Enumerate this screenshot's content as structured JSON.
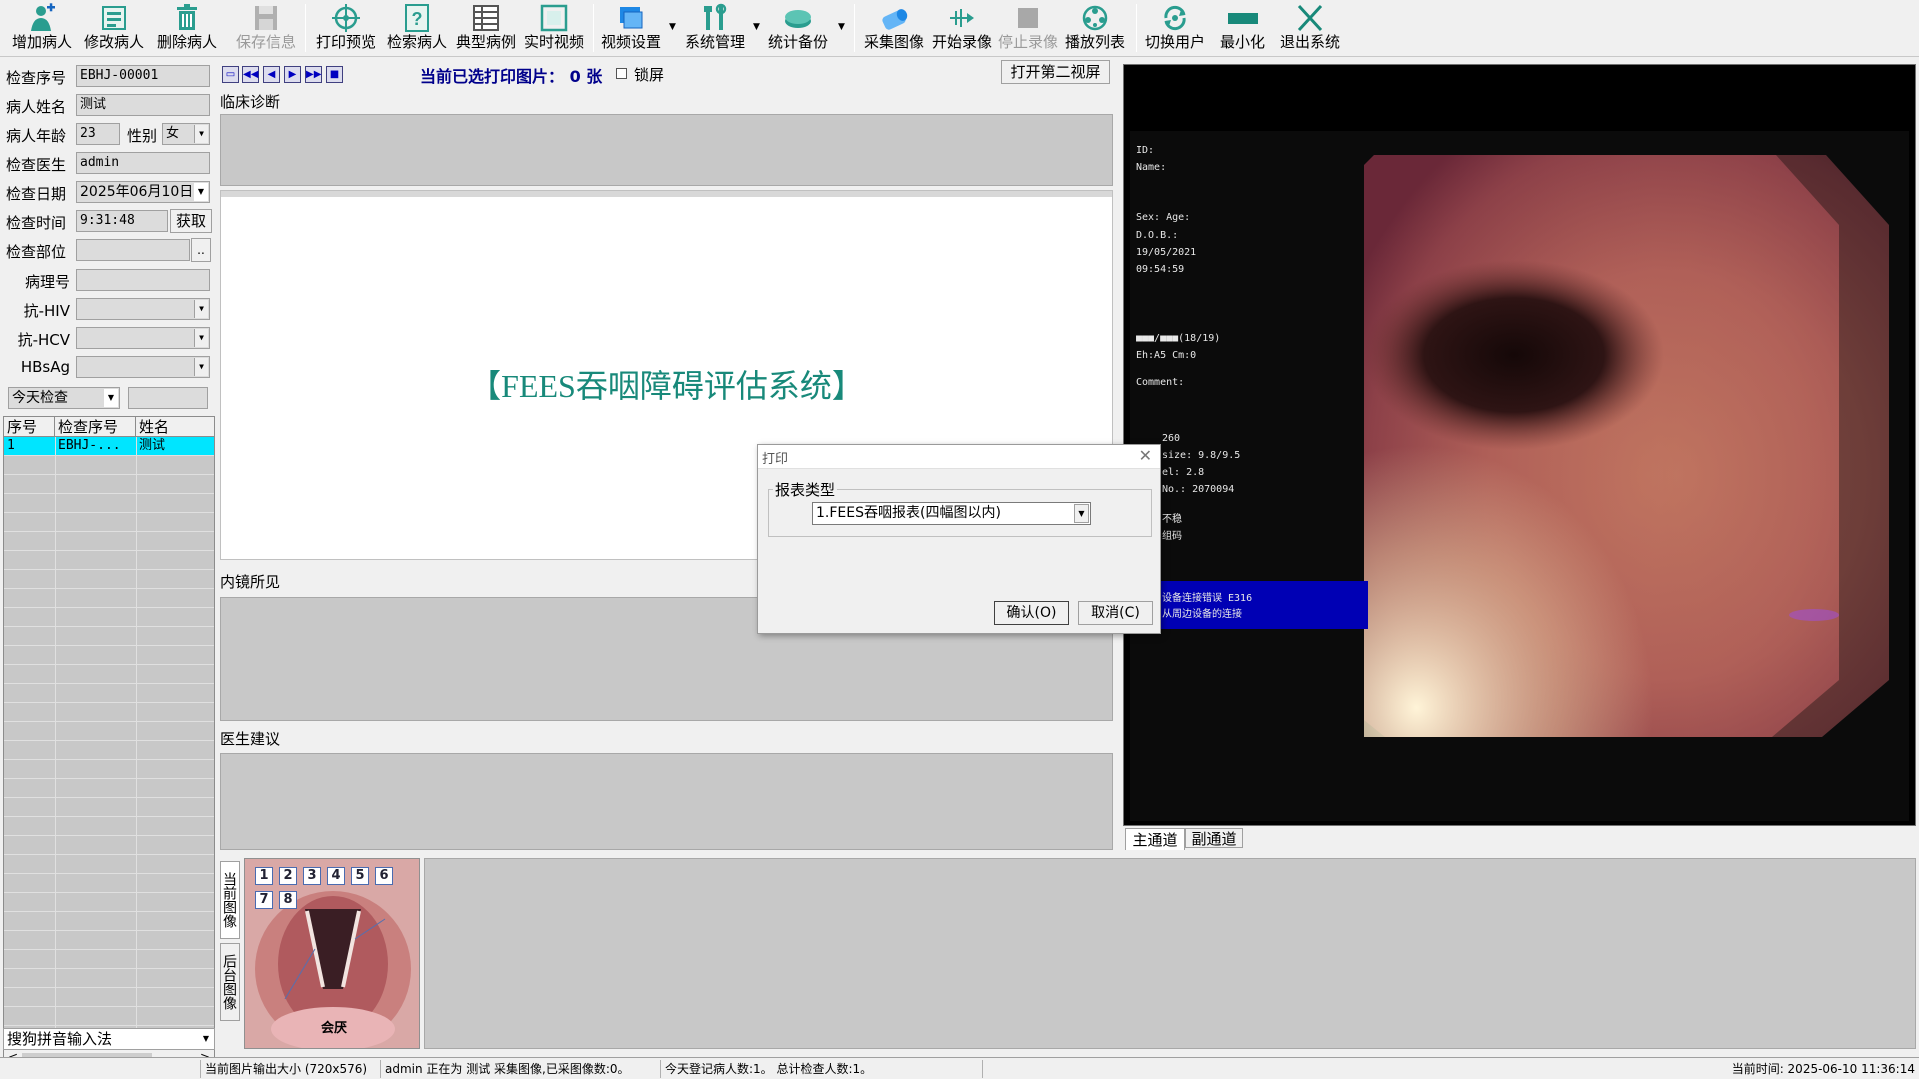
{
  "toolbar": {
    "items": [
      {
        "label": "增加病人",
        "icon": "add-patient-icon"
      },
      {
        "label": "修改病人",
        "icon": "edit-patient-icon"
      },
      {
        "label": "删除病人",
        "icon": "delete-patient-icon"
      },
      {
        "label": "保存信息",
        "icon": "save-info-icon"
      },
      {
        "label": "打印预览",
        "icon": "print-preview-icon"
      },
      {
        "label": "检索病人",
        "icon": "search-patient-icon"
      },
      {
        "label": "典型病例",
        "icon": "typical-case-icon"
      },
      {
        "label": "实时视频",
        "icon": "live-video-icon"
      },
      {
        "label": "视频设置",
        "icon": "video-settings-icon"
      },
      {
        "label": "系统管理",
        "icon": "system-admin-icon"
      },
      {
        "label": "统计备份",
        "icon": "stats-backup-icon"
      },
      {
        "label": "采集图像",
        "icon": "capture-image-icon"
      },
      {
        "label": "开始录像",
        "icon": "start-record-icon"
      },
      {
        "label": "停止录像",
        "icon": "stop-record-icon"
      },
      {
        "label": "播放列表",
        "icon": "playlist-icon"
      },
      {
        "label": "切换用户",
        "icon": "switch-user-icon"
      },
      {
        "label": "最小化",
        "icon": "minimize-icon"
      },
      {
        "label": "退出系统",
        "icon": "exit-icon"
      }
    ]
  },
  "patient": {
    "exam_no_label": "检查序号",
    "exam_no": "EBHJ-00001",
    "name_label": "病人姓名",
    "name": "测试",
    "age_label": "病人年龄",
    "age": "23",
    "sex_label": "性别",
    "sex": "女",
    "doctor_label": "检查医生",
    "doctor": "admin",
    "date_label": "检查日期",
    "date": "2025年06月10日",
    "time_label": "检查时间",
    "time": "9:31:48",
    "get_button": "获取",
    "site_label": "检查部位",
    "site_button": "..",
    "pathology_label": "病理号",
    "hiv_label": "抗-HIV",
    "hcv_label": "抗-HCV",
    "hbsag_label": "HBsAg",
    "filter": "今天检查"
  },
  "grid": {
    "headers": [
      "序号",
      "检查序号",
      "姓名"
    ],
    "rows": [
      [
        "1",
        "EBHJ-...",
        "测试"
      ]
    ],
    "scroll_left": "<",
    "scroll_right": ">"
  },
  "ime": "搜狗拼音输入法",
  "middle": {
    "selected_text": "当前已选打印图片： 0  张",
    "lock_label": "锁屏",
    "second_screen_button": "打开第二视屏",
    "clinical_label": "临床诊断",
    "system_title": "【FEES吞咽障碍评估系统】",
    "findings_label": "内镜所见",
    "advice_label": "医生建议",
    "current_images_label": "当前图像",
    "background_images_label": "后台图像",
    "anatomy_numbers": [
      "1",
      "2",
      "3",
      "4",
      "5",
      "6",
      "7",
      "8"
    ],
    "anatomy_caption": "会厌"
  },
  "video": {
    "osd": [
      "ID:",
      "Name:",
      "Sex:    Age:",
      "D.O.B.:",
      "19/05/2021",
      "09:54:59",
      "■■■/■■■(18/19)",
      "Eh:A5 Cm:0",
      "Comment:",
      "260",
      "size: 9.8/9.5",
      "el:   2.8",
      "No.: 2070094",
      "不稳",
      "组码"
    ],
    "warning_line1": "设备连接错误 E316",
    "warning_line2": "从周边设备的连接",
    "tab_main": "主通道",
    "tab_sub": "副通道"
  },
  "dialog": {
    "title": "打印",
    "group_label": "报表类型",
    "report_type": "1.FEES吞咽报表(四幅图以内)",
    "ok_button": "确认(O)",
    "cancel_button": "取消(C)"
  },
  "status": {
    "output_size": "当前图片输出大小 (720x576)",
    "activity": "admin 正在为 测试 采集图像,已采图像数:0。",
    "counts": "今天登记病人数:1。 总计检查人数:1。",
    "current_time": "当前时间: 2025-06-10 11:36:14"
  },
  "colors": {
    "title_teal": "#18897a",
    "selected_row": "#00e5ff",
    "warning_blue": "#0000b4"
  }
}
